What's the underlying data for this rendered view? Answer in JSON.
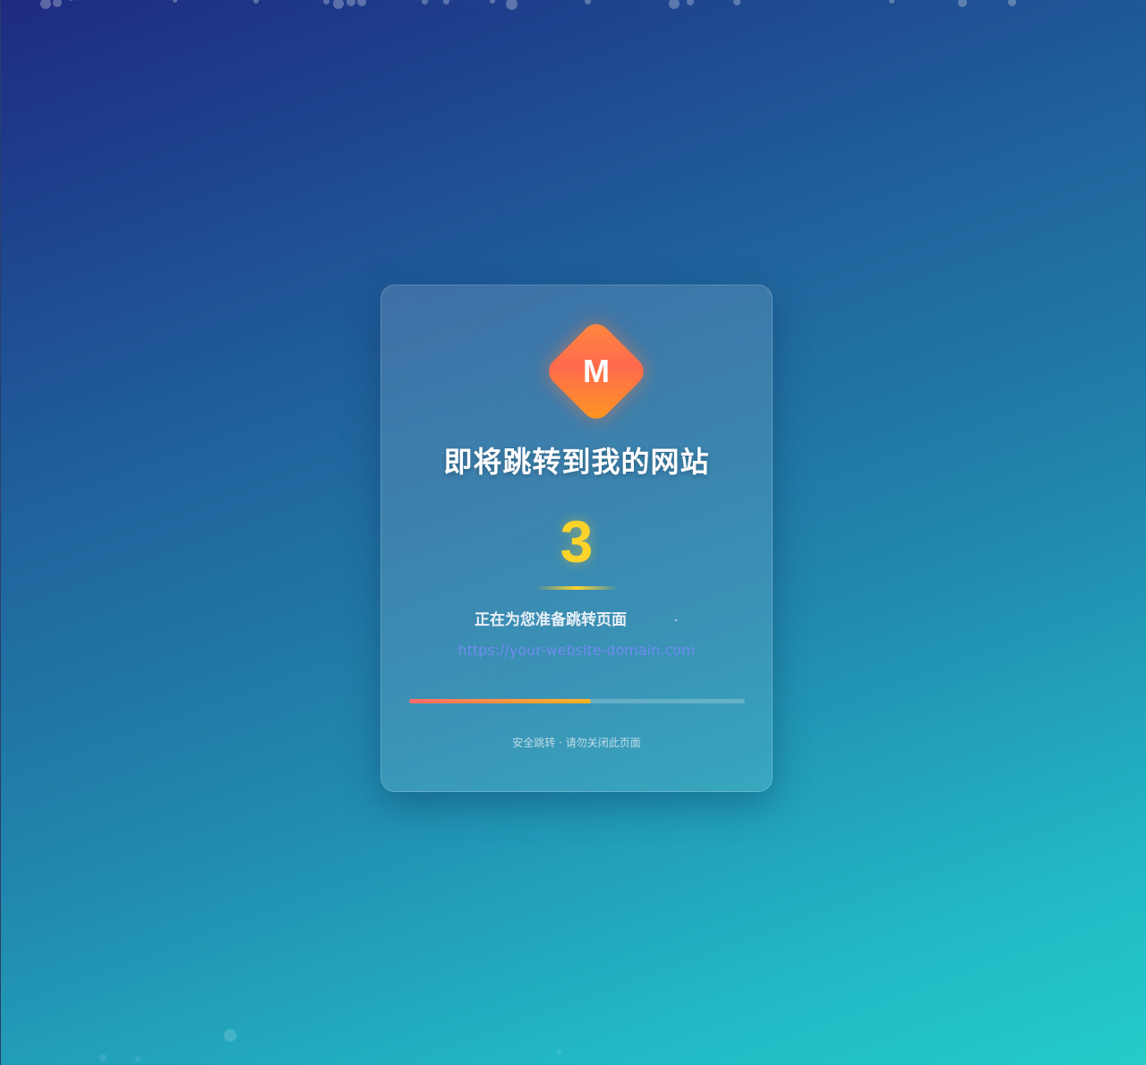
{
  "logo": {
    "letter": "M",
    "icon": "diamond-logo-icon"
  },
  "title": "即将跳转到我的网站",
  "countdown": "3",
  "status_text": "正在为您准备跳转页面",
  "target_url": "https://your-website-domain.com",
  "progress": {
    "fraction": 0.54
  },
  "footer_note": "安全跳转 · 请勿关闭此页面",
  "colors": {
    "countdown": "#ffd42a",
    "link": "#6f8cf0",
    "logo_start": "#ff6a4e",
    "logo_end": "#ff9a1c",
    "progress_start": "#ff6b6b",
    "progress_end": "#ffb326"
  }
}
